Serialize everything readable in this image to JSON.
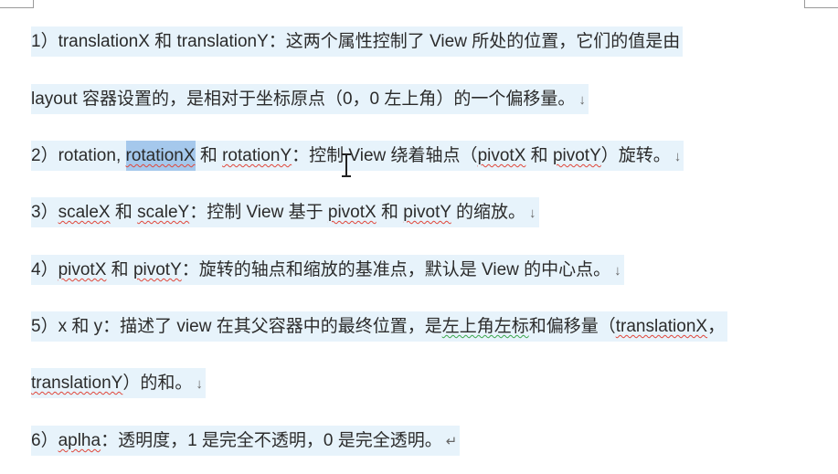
{
  "paragraphs": [
    {
      "p1": "1）translationX 和 translationY：这两个属性控制了 View 所处的位置，它们的值是由",
      "p2": "layout 容器设置的，是相对于坐标原点（0，0 左上角）的一个偏移量。",
      "mark": "↓"
    },
    {
      "a": "2）rotation, ",
      "selected": "rotationX",
      "b": " 和 ",
      "c": "rotationY",
      "d": "：控制 View 绕着轴点（",
      "e": "pivotX",
      "f": " 和 ",
      "g": "pivotY",
      "h": "）旋转。",
      "mark": "↓"
    },
    {
      "a": "3）",
      "b": "scaleX",
      "c": " 和 ",
      "d": "scaleY",
      "e": "：控制 View 基于 ",
      "f": "pivotX",
      "g": " 和 ",
      "h": "pivotY",
      "i": " 的缩放。",
      "mark": "↓"
    },
    {
      "a": "4）",
      "b": "pivotX",
      "c": " 和 ",
      "d": "pivotY",
      "e": "：旋转的轴点和缩放的基准点，默认是 View 的中心点。",
      "mark": "↓"
    },
    {
      "a": "5）x 和 y：描述了 view 在其父容器中的最终位置，是",
      "b": "左上角左标",
      "c": "和偏移量（",
      "d": "translationX",
      "e": "，",
      "f": "translationY",
      "g": "）的和。",
      "mark": "↓"
    },
    {
      "a": "6）",
      "b": "aplha",
      "c": "：透明度，1 是完全不透明，0 是完全透明。",
      "mark": "↵"
    }
  ]
}
